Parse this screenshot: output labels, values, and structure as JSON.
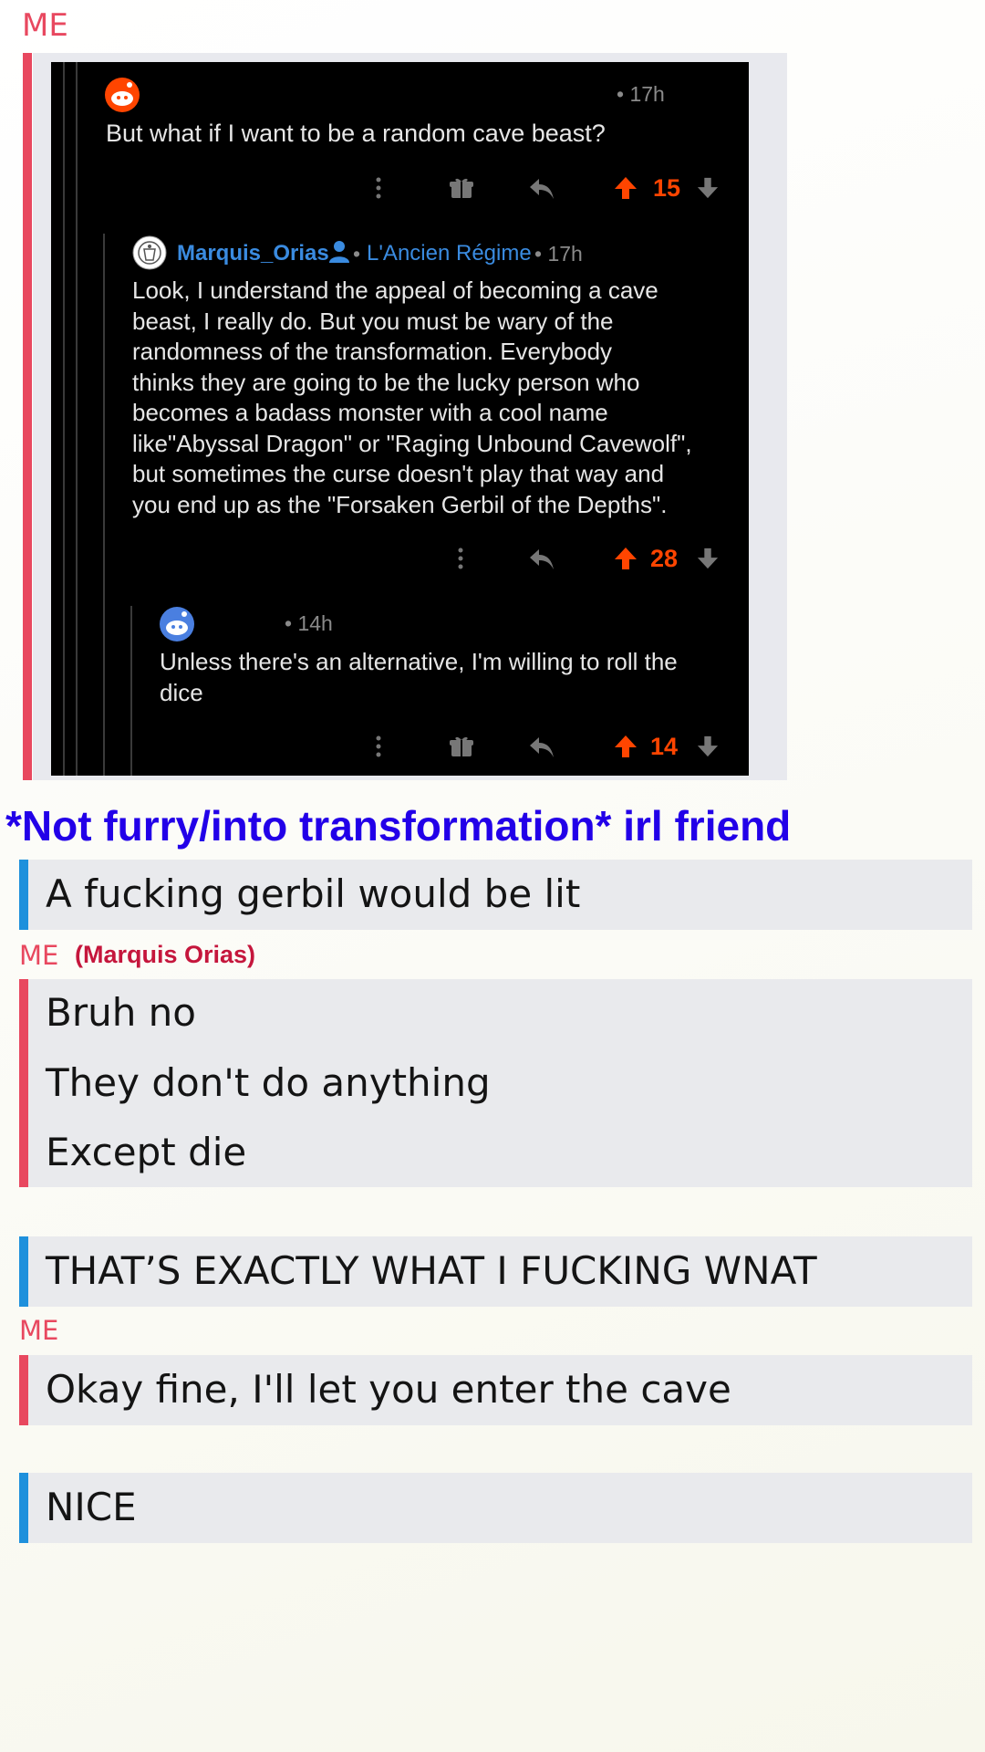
{
  "me_label": "ME",
  "screenshot": {
    "comment1": {
      "time": "• 17h",
      "text": "But what if I want to be a random cave beast?",
      "score": "15"
    },
    "comment2": {
      "username": "Marquis_Orias",
      "flair": "L'Ancien Régime",
      "time": "• 17h",
      "lines": [
        "Look, I understand the appeal of becoming a cave",
        "beast, I really do. But you must be wary of the",
        "randomness of the transformation. Everybody",
        "thinks they are going to be the lucky person who",
        "becomes a badass monster with a cool name",
        "like\"Abyssal Dragon\" or \"Raging Unbound Cavewolf\",",
        "but sometimes the curse doesn't play that way and",
        "you end up as the \"Forsaken Gerbil of the Depths\"."
      ],
      "score": "28"
    },
    "comment3": {
      "time": "• 14h",
      "lines": [
        "Unless there's an alternative, I'm willing to roll the",
        "dice"
      ],
      "score": "14"
    }
  },
  "caption": "*Not furry/into transformation* irl friend",
  "messages": {
    "m1": "A fucking gerbil would be lit",
    "me2_label": "ME",
    "me2_note": "(Marquis Orias)",
    "m2a": "Bruh no",
    "m2b": "They don't do anything",
    "m2c": "Except die",
    "m3": "THAT’S EXACTLY WHAT I FUCKING WNAT",
    "me3_label": "ME",
    "m4": "Okay fine, I'll let you enter the cave",
    "m5": "NICE"
  },
  "colors": {
    "me_accent": "#e8485f",
    "friend_accent": "#1e90dc",
    "caption": "#2200e8",
    "upvote": "#ff4500",
    "username": "#3a8be0"
  },
  "icons": [
    "snoo-avatar-icon",
    "more-options-icon",
    "gift-icon",
    "reply-icon",
    "upvote-arrow-icon",
    "downvote-arrow-icon",
    "user-profile-icon"
  ]
}
